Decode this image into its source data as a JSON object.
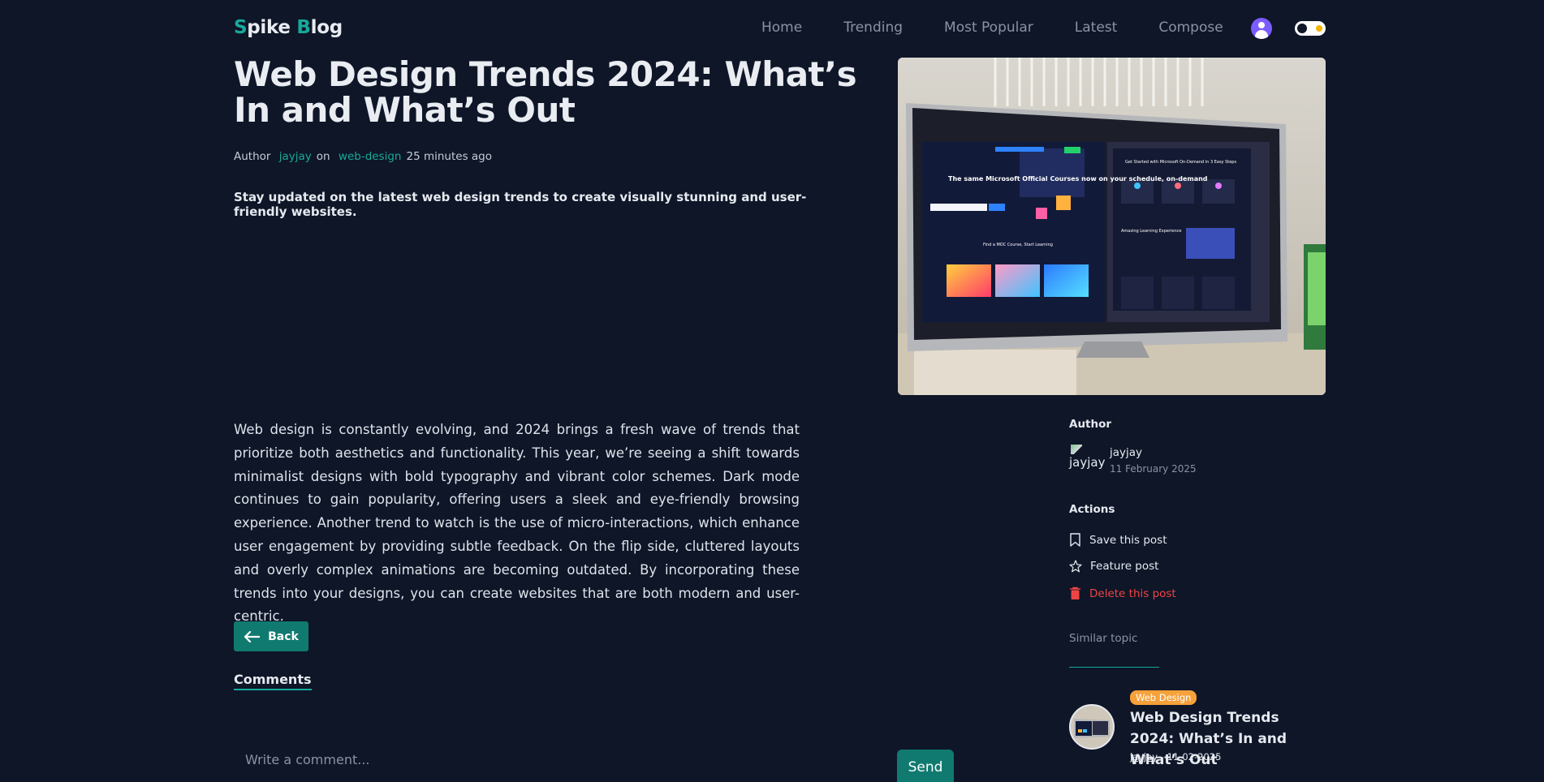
{
  "header": {
    "logo_s": "S",
    "logo_mid": "pike ",
    "logo_b": "B",
    "logo_end": "log",
    "nav": [
      {
        "label": "Home"
      },
      {
        "label": "Trending"
      },
      {
        "label": "Most Popular"
      },
      {
        "label": "Latest"
      },
      {
        "label": "Compose"
      }
    ]
  },
  "post": {
    "title": "Web Design Trends 2024: What’s In and What’s Out",
    "meta_author_label": "Author",
    "author": "jayjay",
    "meta_on": "on",
    "category": "web-design",
    "time_ago": "25 minutes ago",
    "lead": "Stay updated on the latest web design trends to create visually stunning and user-friendly websites.",
    "body": "Web design is constantly evolving, and 2024 brings a fresh wave of trends that prioritize both aesthetics and functionality. This year, we’re seeing a shift towards minimalist designs with bold typography and vibrant color schemes. Dark mode continues to gain popularity, offering users a sleek and eye-friendly browsing experience. Another trend to watch is the use of micro-interactions, which enhance user engagement by providing subtle feedback. On the flip side, cluttered layouts and overly complex animations are becoming outdated. By incorporating these trends into your designs, you can create websites that are both modern and user-centric.",
    "back_label": "Back",
    "hero_overlay": {
      "headline": "The same Microsoft Official Courses now on your schedule, on-demand",
      "section": "Find a MOC Course, Start Learning",
      "panel_title": "Get Started with Microsoft On-Demand in 3 Easy Steps",
      "panel_sub": "Amazing Learning Experience"
    }
  },
  "comments": {
    "heading": "Comments",
    "placeholder": "Write a comment...",
    "send_label": "Send"
  },
  "sidebar": {
    "author_heading": "Author",
    "author_pic_alt": "jayjay",
    "author_name": "jayjay",
    "author_date": "11 February 2025",
    "actions_heading": "Actions",
    "actions": [
      {
        "label": "Save this post"
      },
      {
        "label": "Feature post"
      },
      {
        "label": "Delete this post"
      }
    ],
    "similar_heading": "Similar topic",
    "related": {
      "badge": "Web Design",
      "title": "Web Design Trends 2024: What’s In and What’s Out",
      "author": "jayjay",
      "date": "11-02-2025"
    }
  },
  "colors": {
    "background": "#0e1628",
    "accent": "#18a999",
    "button": "#117a70",
    "danger": "#ef4444",
    "badge": "#f6a13a",
    "avatar": "#7b5cff"
  }
}
